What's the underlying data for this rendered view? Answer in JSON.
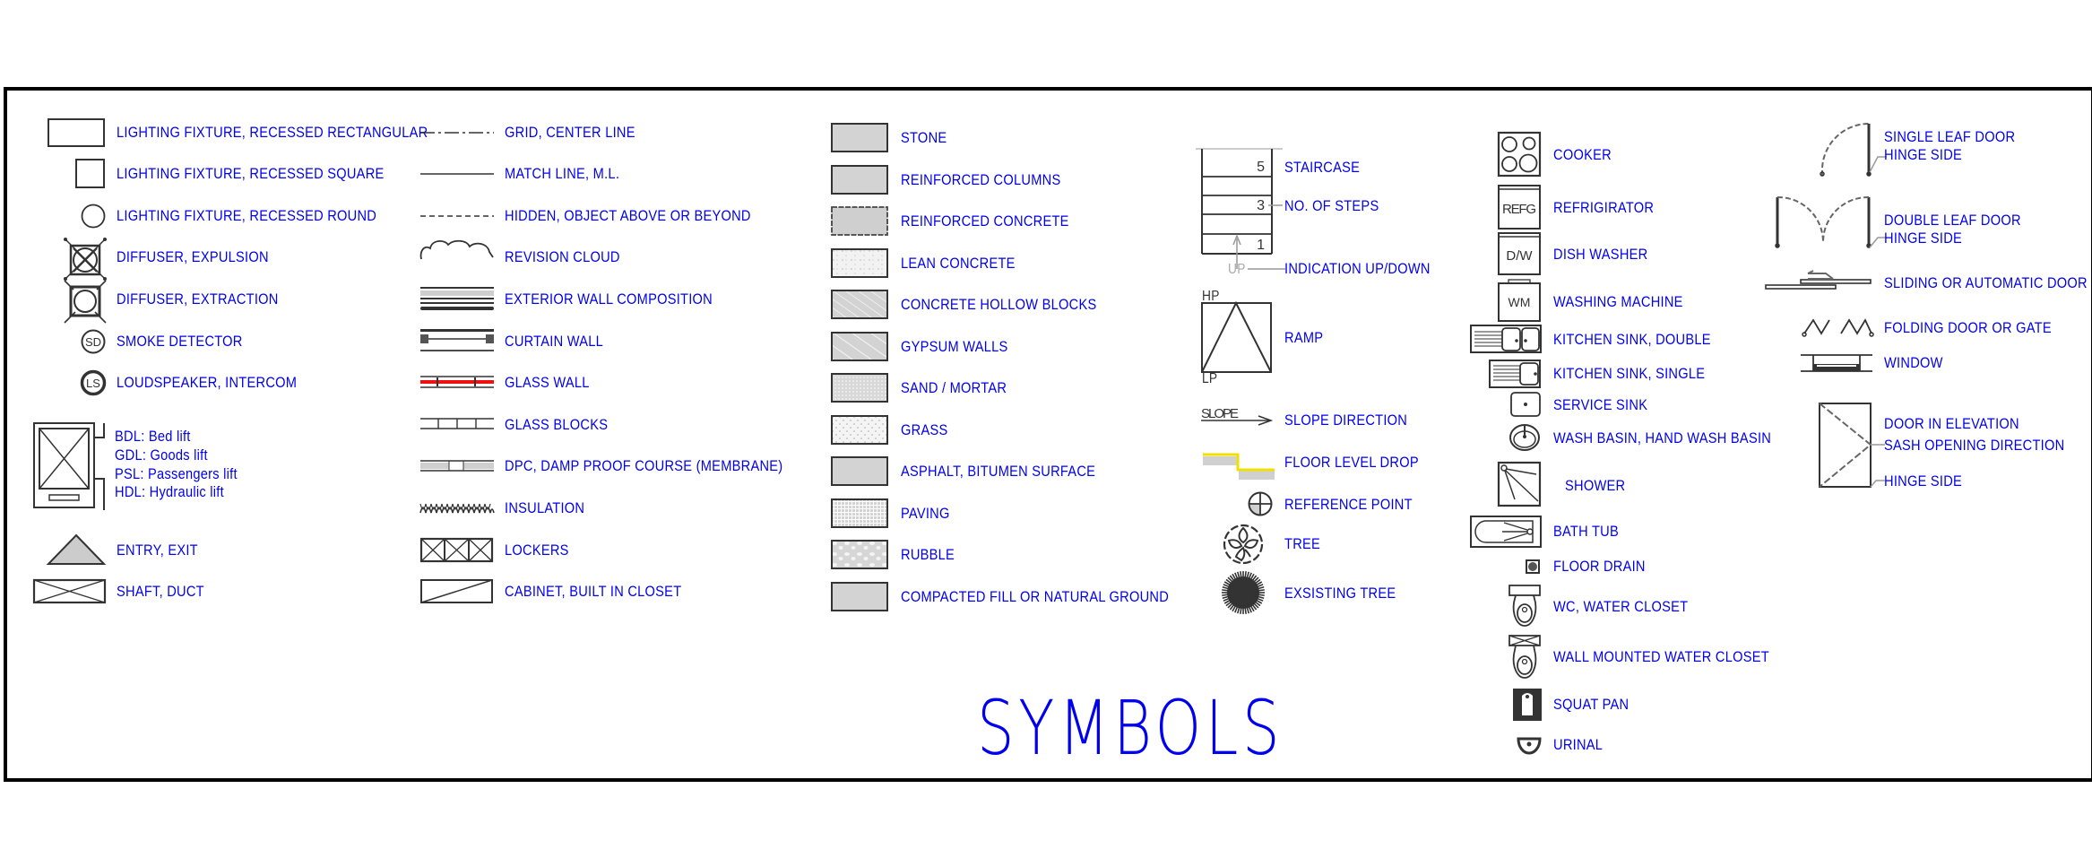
{
  "title": "SYMBOLS",
  "colors": {
    "label": "#0000ee",
    "line": "#333333",
    "fill": "#d3d3d3",
    "accent_red": "#ee1111",
    "accent_yellow": "#f0e000"
  },
  "column1": [
    {
      "icon": "recessed-rectangular-fixture-icon",
      "label": "LIGHTING FIXTURE, RECESSED RECTANGULAR"
    },
    {
      "icon": "recessed-square-fixture-icon",
      "label": "LIGHTING FIXTURE, RECESSED SQUARE"
    },
    {
      "icon": "recessed-round-fixture-icon",
      "label": "LIGHTING FIXTURE, RECESSED ROUND"
    },
    {
      "icon": "diffuser-expulsion-icon",
      "label": "DIFFUSER, EXPULSION"
    },
    {
      "icon": "diffuser-extraction-icon",
      "label": "DIFFUSER, EXTRACTION"
    },
    {
      "icon": "smoke-detector-icon",
      "label": "SMOKE DETECTOR",
      "glyph": "SD"
    },
    {
      "icon": "loudspeaker-icon",
      "label": "LOUDSPEAKER, INTERCOM",
      "glyph": "LS"
    }
  ],
  "lift": {
    "icon": "lift-icon",
    "lines": [
      "BDL: Bed lift",
      "GDL: Goods lift",
      "PSL: Passengers lift",
      "HDL: Hydraulic lift"
    ]
  },
  "column1b": [
    {
      "icon": "entry-exit-icon",
      "label": "ENTRY, EXIT"
    },
    {
      "icon": "shaft-duct-icon",
      "label": "SHAFT, DUCT"
    }
  ],
  "column2": [
    {
      "icon": "grid-center-line-icon",
      "label": "GRID, CENTER LINE"
    },
    {
      "icon": "match-line-icon",
      "label": "MATCH LINE, M.L."
    },
    {
      "icon": "hidden-line-icon",
      "label": "HIDDEN, OBJECT ABOVE OR BEYOND"
    },
    {
      "icon": "revision-cloud-icon",
      "label": "REVISION CLOUD"
    },
    {
      "icon": "exterior-wall-icon",
      "label": "EXTERIOR WALL COMPOSITION"
    },
    {
      "icon": "curtain-wall-icon",
      "label": "CURTAIN WALL"
    },
    {
      "icon": "glass-wall-icon",
      "label": "GLASS WALL"
    },
    {
      "icon": "glass-blocks-icon",
      "label": "GLASS BLOCKS"
    },
    {
      "icon": "dpc-membrane-icon",
      "label": "DPC, DAMP PROOF COURSE (MEMBRANE)"
    },
    {
      "icon": "insulation-icon",
      "label": "INSULATION"
    },
    {
      "icon": "lockers-icon",
      "label": "LOCKERS"
    },
    {
      "icon": "cabinet-closet-icon",
      "label": "CABINET, BUILT IN CLOSET"
    }
  ],
  "column3": [
    {
      "icon": "stone-hatch-icon",
      "label": "STONE"
    },
    {
      "icon": "reinforced-columns-hatch-icon",
      "label": "REINFORCED COLUMNS"
    },
    {
      "icon": "reinforced-concrete-hatch-icon",
      "label": "REINFORCED CONCRETE"
    },
    {
      "icon": "lean-concrete-hatch-icon",
      "label": "LEAN CONCRETE"
    },
    {
      "icon": "concrete-hollow-blocks-hatch-icon",
      "label": "CONCRETE HOLLOW BLOCKS"
    },
    {
      "icon": "gypsum-walls-hatch-icon",
      "label": "GYPSUM WALLS"
    },
    {
      "icon": "sand-mortar-hatch-icon",
      "label": "SAND / MORTAR"
    },
    {
      "icon": "grass-hatch-icon",
      "label": "GRASS"
    },
    {
      "icon": "asphalt-hatch-icon",
      "label": "ASPHALT, BITUMEN SURFACE"
    },
    {
      "icon": "paving-hatch-icon",
      "label": "PAVING"
    },
    {
      "icon": "rubble-hatch-icon",
      "label": "RUBBLE"
    },
    {
      "icon": "compacted-fill-hatch-icon",
      "label": "COMPACTED FILL OR NATURAL GROUND"
    }
  ],
  "column4": {
    "staircase": {
      "label": "STAIRCASE",
      "step_top": "5",
      "step_mid": "3",
      "step_bottom": "1",
      "steps_label": "NO. OF STEPS",
      "up_text": "UP",
      "updown_label": "INDICATION UP/DOWN"
    },
    "ramp": {
      "label": "RAMP",
      "high": "HP",
      "low": "LP"
    },
    "items": [
      {
        "icon": "slope-direction-icon",
        "label": "SLOPE DIRECTION",
        "glyph": "SLOPE"
      },
      {
        "icon": "floor-level-drop-icon",
        "label": "FLOOR LEVEL DROP"
      },
      {
        "icon": "reference-point-icon",
        "label": "REFERENCE POINT"
      },
      {
        "icon": "tree-icon",
        "label": "TREE"
      },
      {
        "icon": "existing-tree-icon",
        "label": "EXSISTING TREE"
      }
    ]
  },
  "column5": [
    {
      "icon": "cooker-icon",
      "label": "COOKER"
    },
    {
      "icon": "refrigerator-icon",
      "label": "REFRIGIRATOR",
      "glyph": "REFG"
    },
    {
      "icon": "dish-washer-icon",
      "label": "DISH WASHER",
      "glyph": "D/W"
    },
    {
      "icon": "washing-machine-icon",
      "label": "WASHING MACHINE",
      "glyph": "WM"
    },
    {
      "icon": "kitchen-sink-double-icon",
      "label": "KITCHEN SINK, DOUBLE"
    },
    {
      "icon": "kitchen-sink-single-icon",
      "label": "KITCHEN SINK, SINGLE"
    },
    {
      "icon": "service-sink-icon",
      "label": "SERVICE SINK"
    },
    {
      "icon": "wash-basin-icon",
      "label": "WASH BASIN, HAND WASH BASIN"
    },
    {
      "icon": "shower-icon",
      "label": "SHOWER"
    },
    {
      "icon": "bath-tub-icon",
      "label": "BATH TUB"
    },
    {
      "icon": "floor-drain-icon",
      "label": "FLOOR DRAIN"
    },
    {
      "icon": "water-closet-icon",
      "label": "WC, WATER CLOSET"
    },
    {
      "icon": "wall-mounted-wc-icon",
      "label": "WALL MOUNTED WATER CLOSET"
    },
    {
      "icon": "squat-pan-icon",
      "label": "SQUAT PAN"
    },
    {
      "icon": "urinal-icon",
      "label": "URINAL"
    }
  ],
  "column6": [
    {
      "icon": "single-leaf-door-icon",
      "label": "SINGLE LEAF DOOR",
      "sub": "HINGE SIDE"
    },
    {
      "icon": "double-leaf-door-icon",
      "label": "DOUBLE LEAF DOOR",
      "sub": "HINGE SIDE"
    },
    {
      "icon": "sliding-door-icon",
      "label": "SLIDING OR AUTOMATIC DOOR"
    },
    {
      "icon": "folding-door-icon",
      "label": "FOLDING DOOR OR GATE"
    },
    {
      "icon": "window-icon",
      "label": "WINDOW"
    },
    {
      "icon": "door-elevation-icon",
      "label": "DOOR IN ELEVATION",
      "sub": "SASH OPENING DIRECTION",
      "sub2": "HINGE SIDE"
    }
  ]
}
